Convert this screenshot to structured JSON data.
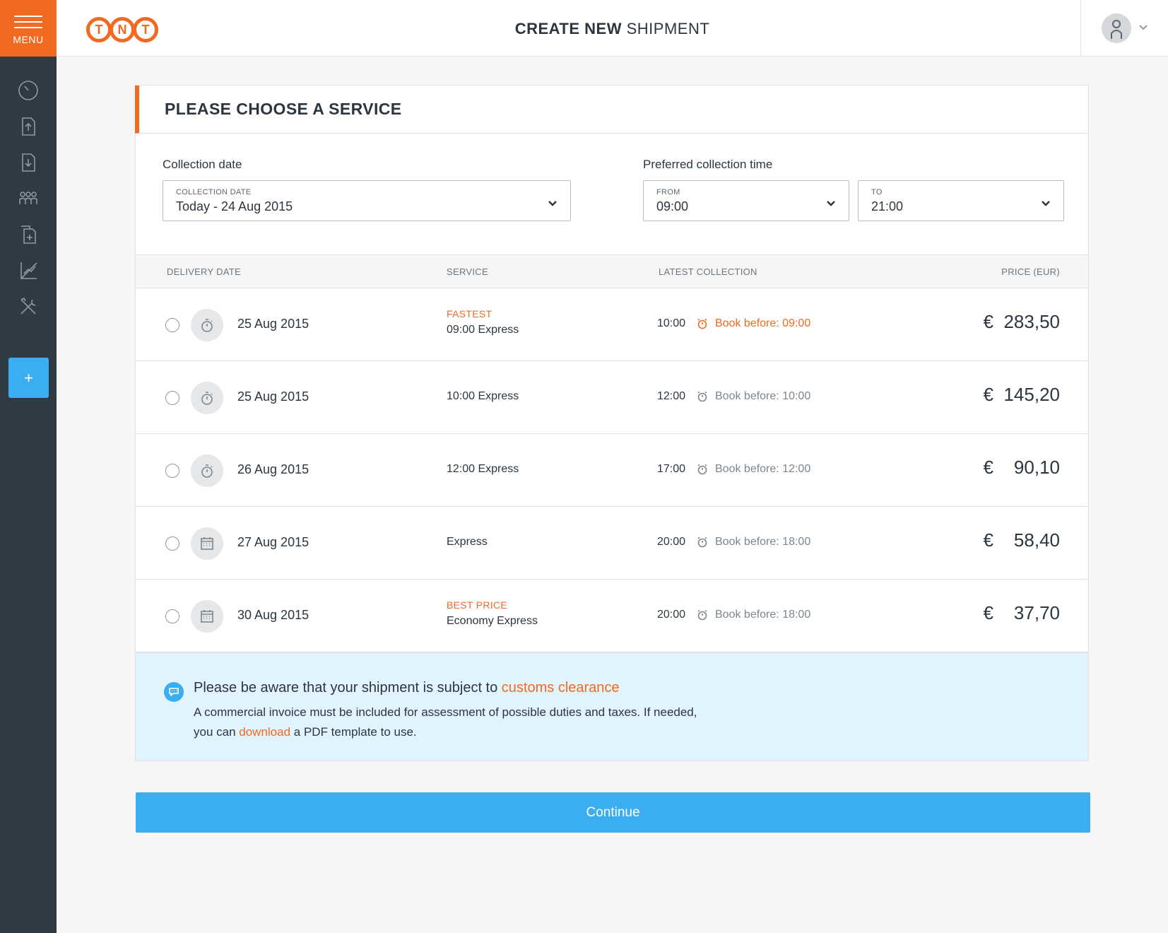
{
  "sidebar": {
    "menu_label": "MENU",
    "add_label": "+"
  },
  "header": {
    "logo_letters": [
      "T",
      "N",
      "T"
    ],
    "title_bold": "CREATE NEW",
    "title_rest": "SHIPMENT"
  },
  "card": {
    "title": "PLEASE CHOOSE A SERVICE",
    "collection_date_label": "Collection date",
    "collection_date_field_label": "COLLECTION DATE",
    "collection_date_value": "Today - 24 Aug 2015",
    "preferred_time_label": "Preferred collection time",
    "from_label": "FROM",
    "from_value": "09:00",
    "to_label": "TO",
    "to_value": "21:00"
  },
  "table": {
    "headers": [
      "DELIVERY DATE",
      "SERVICE",
      "LATEST COLLECTION",
      "PRICE (EUR)"
    ],
    "currency": "€",
    "rows": [
      {
        "date": "25 Aug 2015",
        "badge": "FASTEST",
        "service": "09:00 Express",
        "latest": "10:00",
        "book": "Book before: 09:00",
        "price": "283,50"
      },
      {
        "date": "25 Aug 2015",
        "badge": "",
        "service": "10:00 Express",
        "latest": "12:00",
        "book": "Book before: 10:00",
        "price": "145,20"
      },
      {
        "date": "26 Aug 2015",
        "badge": "",
        "service": "12:00 Express",
        "latest": "17:00",
        "book": "Book before: 12:00",
        "price": "90,10"
      },
      {
        "date": "27 Aug 2015",
        "badge": "",
        "service": "Express",
        "latest": "20:00",
        "book": "Book before: 18:00",
        "price": "58,40"
      },
      {
        "date": "30 Aug 2015",
        "badge": "BEST PRICE",
        "service": "Economy Express",
        "latest": "20:00",
        "book": "Book before: 18:00",
        "price": "37,70"
      }
    ]
  },
  "notice": {
    "title_prefix": "Please be aware that your shipment is subject to ",
    "title_link": "customs clearance",
    "body_1": "A commercial invoice must be included for assessment of possible duties and taxes. If needed,",
    "body_2_prefix": "you can ",
    "body_2_link": "download",
    "body_2_suffix": " a PDF template to use."
  },
  "continue_label": "Continue",
  "colors": {
    "brand_orange": "#f26a21",
    "accent_blue": "#3aaef0",
    "sidebar_bg": "#2e3a44"
  }
}
